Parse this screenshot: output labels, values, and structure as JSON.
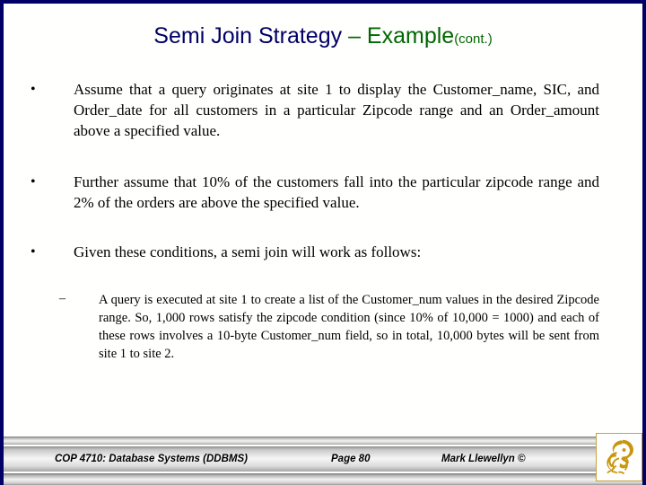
{
  "slide": {
    "title": {
      "main": "Semi Join Strategy ",
      "dash_accent": "– Example",
      "suffix": "(cont.)",
      "main_color": "#000066",
      "accent_color": "#006600"
    },
    "border_color": "#000066",
    "background_color": "#fffffd",
    "bullets": [
      {
        "level": 1,
        "marker": "•",
        "text": "Assume that a query originates at site 1 to display the Customer_name, SIC, and Order_date for all customers in a particular Zipcode range and an Order_amount above a specified value."
      },
      {
        "level": 1,
        "marker": "•",
        "text": "Further assume that 10% of the customers fall into the particular zipcode range and 2% of the orders are above the specified value."
      },
      {
        "level": 1,
        "marker": "•",
        "text": "Given these conditions, a semi join will work as follows:"
      },
      {
        "level": 2,
        "marker": "–",
        "text": "A query is executed at site 1 to create a list of the Customer_num values in the desired Zipcode range.  So, 1,000 rows satisfy the zipcode condition (since 10% of 10,000 = 1000) and each of these rows involves a 10-byte Customer_num field, so in total, 10,000 bytes will be sent from site 1 to site 2."
      }
    ],
    "footer": {
      "course": "COP 4710: Database Systems  (DDBMS)",
      "page": "Page 80",
      "author": "Mark Llewellyn ©",
      "logo_name": "ucf-pegasus-logo",
      "logo_color": "#c8960c"
    }
  }
}
